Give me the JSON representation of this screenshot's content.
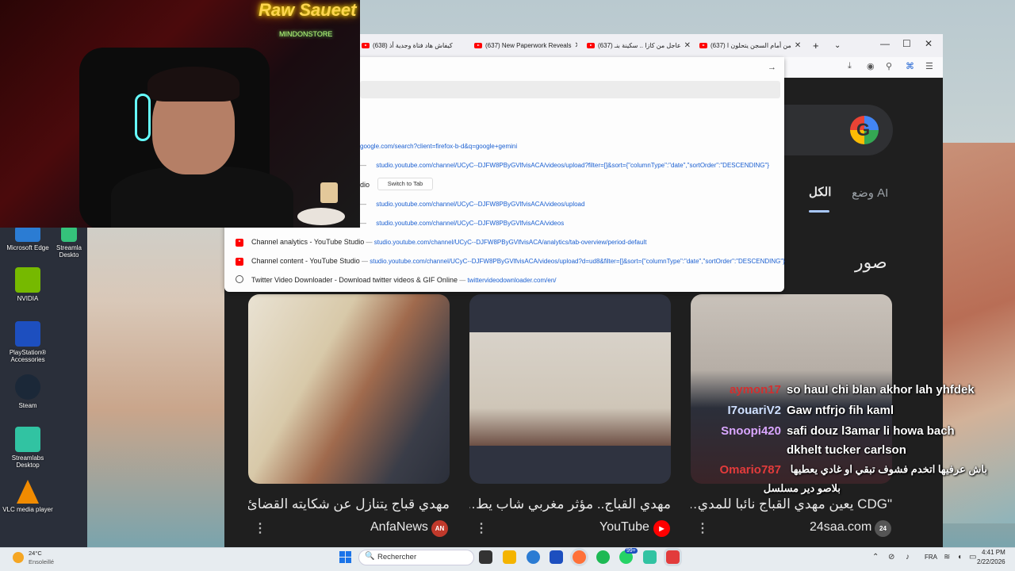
{
  "browser": {
    "tabs": [
      {
        "label": "(638) كيفاش هاد فتاة وجدية أذ",
        "icon": "youtube-icon"
      },
      {
        "label": "(637) New Paperwork Reveals",
        "icon": "youtube-icon"
      },
      {
        "label": "(637) عاجل من كازا .. سكينة بنـ",
        "icon": "youtube-icon"
      },
      {
        "label": "(637) من أمام السجن يتحلون ا",
        "icon": "youtube-icon"
      }
    ],
    "new_tab_symbol": "+",
    "go_arrow": "→",
    "window_controls": [
      "—",
      "☐",
      "✕"
    ]
  },
  "dropdown": {
    "suggestions": [
      {
        "title": "",
        "url": "google.com/search?client=firefox-b-d&q=google+gemini"
      },
      {
        "title": "",
        "url": "studio.youtube.com/channel/UCyC--DJFW8PByGVlfvisACA/videos/upload?filter=[]&sort={\"columnType\":\"date\",\"sortOrder\":\"DESCENDING\"}"
      },
      {
        "title": "dio",
        "url": "",
        "action": "Switch to Tab"
      },
      {
        "title": "",
        "url": "studio.youtube.com/channel/UCyC--DJFW8PByGVlfvisACA/videos/upload"
      },
      {
        "title": "",
        "url": "studio.youtube.com/channel/UCyC--DJFW8PByGVlfvisACA/videos"
      },
      {
        "title": "Channel analytics - YouTube Studio",
        "url": "studio.youtube.com/channel/UCyC--DJFW8PByGVlfvisACA/analytics/tab-overview/period-default"
      },
      {
        "title": "Channel content - YouTube Studio",
        "url": "studio.youtube.com/channel/UCyC--DJFW8PByGVlfvisACA/videos/upload?d=ud8&filter=[]&sort={\"columnType\":\"date\",\"sortOrder\":\"DESCENDING\"}"
      },
      {
        "title": "Twitter Video Downloader - Download twitter videos & GIF Online",
        "url": "twittervideodownloader.com/en/"
      }
    ],
    "separator": "—"
  },
  "search_page": {
    "tab_all": "الكل",
    "tab_ai": "وضع AI",
    "images_heading": "صور",
    "cards": [
      {
        "title": "مهدي قباج يتنازل عن شكايته القضائ…",
        "source": "AnfaNews",
        "badge": "AN",
        "badge_color": "#c0392b"
      },
      {
        "title": "مهدي القباج.. مؤثر مغربي شاب يط…",
        "source": "YouTube",
        "badge": "▶",
        "badge_color": "#ff0000"
      },
      {
        "title": "\"CDG يعين مهدي القباج نائبا للمدي…",
        "source": "24saa.com",
        "badge": "24",
        "badge_color": "#555555"
      }
    ],
    "more_symbol": "⋮"
  },
  "webcam": {
    "neon_title": "Raw Saueet",
    "neon_sub": "MINDONSTORE"
  },
  "chat": [
    {
      "name": "aymon17",
      "name_color": "#d03030",
      "message": "so hauI chi blan akhor lah yhfdek"
    },
    {
      "name": "I7ouariV2",
      "name_color": "#cfe0ff",
      "message": "Gaw ntfrjo fih kaml"
    },
    {
      "name": "Snoopi420",
      "name_color": "#d9a6ff",
      "message": "safi douz l3amar li howa bach"
    },
    {
      "name": "",
      "name_color": "#ffffff",
      "message": "dkhelt tucker carlson"
    },
    {
      "name": "Omario787",
      "name_color": "#e23b3b",
      "message": "باش عرفيها اتخدم فشوف تبقي او غادي يعطيها"
    },
    {
      "name": "",
      "name_color": "#ffffff",
      "message": "بلاصو دير مسلسل"
    }
  ],
  "desktop": {
    "icons": [
      {
        "label": "Microsoft Edge",
        "color": "#2b7cd3"
      },
      {
        "label": "Streamla Deskto",
        "color": "#35c27b"
      },
      {
        "label": "NVIDIA",
        "color": "#76b900"
      },
      {
        "label": "PlayStation® Accessories",
        "color": "#1d4fbf"
      },
      {
        "label": "Steam",
        "color": "#1b2838"
      },
      {
        "label": "Streamlabs Desktop",
        "color": "#31c3a2"
      },
      {
        "label": "VLC media player",
        "color": "#f18b00"
      }
    ]
  },
  "taskbar": {
    "weather_temp": "24°C",
    "weather_desc": "Ensoleillé",
    "search_placeholder": "Rechercher",
    "search_icon": "🔍",
    "lang": "FRA",
    "time": "4:41 PM",
    "date": "2/22/2026",
    "badge_count": "99+"
  }
}
